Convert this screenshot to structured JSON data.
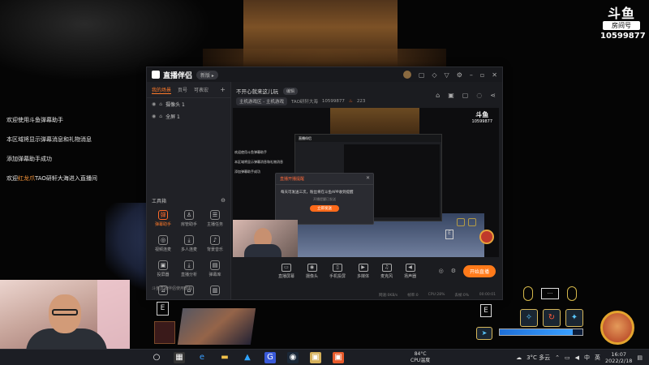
{
  "watermark": {
    "logo": "斗鱼",
    "subtitle": "房间号",
    "room_number": "10599877"
  },
  "chat": [
    {
      "text": "欢迎使用斗鱼弹幕助手"
    },
    {
      "text": "本区域将显示弹幕消息和礼物消息"
    },
    {
      "text": "添加弹幕助手成功"
    },
    {
      "prefix": "欢迎",
      "name": "红龙爪",
      "suffix": "TAO研轩大海进入直播间"
    }
  ],
  "app": {
    "title": "直播伴侣",
    "version_pill": "新版 ▸",
    "tabs": [
      "我的场景",
      "页号",
      "可表宏"
    ],
    "tab_add": "+",
    "scenes": [
      {
        "label": "摄像头 1"
      },
      {
        "label": "全屏 1"
      }
    ],
    "tools_title": "工具箱",
    "tools": [
      {
        "label": "弹幕助手",
        "icon": "弹",
        "active": true
      },
      {
        "label": "房管助手",
        "icon": "♙",
        "active": false
      },
      {
        "label": "主播任务",
        "icon": "☰",
        "active": false
      },
      {
        "label": "视频连麦",
        "icon": "◎",
        "active": false
      },
      {
        "label": "多人连麦",
        "icon": "⤓",
        "active": false
      },
      {
        "label": "背景音乐",
        "icon": "♪",
        "active": false
      },
      {
        "label": "投屏器",
        "icon": "▣",
        "active": false
      },
      {
        "label": "直播分析",
        "icon": "⤓",
        "active": false
      },
      {
        "label": "弹幕库",
        "icon": "▤",
        "active": false
      },
      {
        "label": "",
        "icon": "⊿",
        "active": false
      },
      {
        "label": "",
        "icon": "⌂",
        "active": false
      },
      {
        "label": "",
        "icon": "▥",
        "active": false
      }
    ],
    "footer_text": "斗鱼直播伴侣使用教程",
    "stream_title": "不开心就来这儿玩",
    "edit_label": "编辑",
    "category": "主机游戏区 - 主机游戏",
    "streamer": "TAO研轩大海",
    "room_id": "10599877",
    "popularity": "223",
    "dialog": {
      "title": "直播开播提醒",
      "message": "每天可发送三次，粉丝将在斗鱼APP收到提醒",
      "hint": "开播提醒已发送",
      "button": "立即发送"
    },
    "controls": [
      {
        "label": "直播屏幕",
        "icon": "▭"
      },
      {
        "label": "摄像头",
        "icon": "◉"
      },
      {
        "label": "手机投屏",
        "icon": "▯"
      },
      {
        "label": "多媒体",
        "icon": "▶"
      },
      {
        "label": "麦克风",
        "icon": "♫"
      },
      {
        "label": "扬声器",
        "icon": "◀"
      }
    ],
    "live_button": "开始直播",
    "status": [
      "网速:0KB/s",
      "帧率:0",
      "CPU:28%",
      "丢帧:0%"
    ],
    "time": "00:00:01"
  },
  "taskbar": {
    "temp_value": "84°C",
    "temp_label": "CPU温度",
    "weather": "3°C 多云",
    "ime": "中",
    "lang": "英",
    "time": "16:07",
    "date": "2022/2/18"
  },
  "hud": {
    "hp_percent": 88
  }
}
